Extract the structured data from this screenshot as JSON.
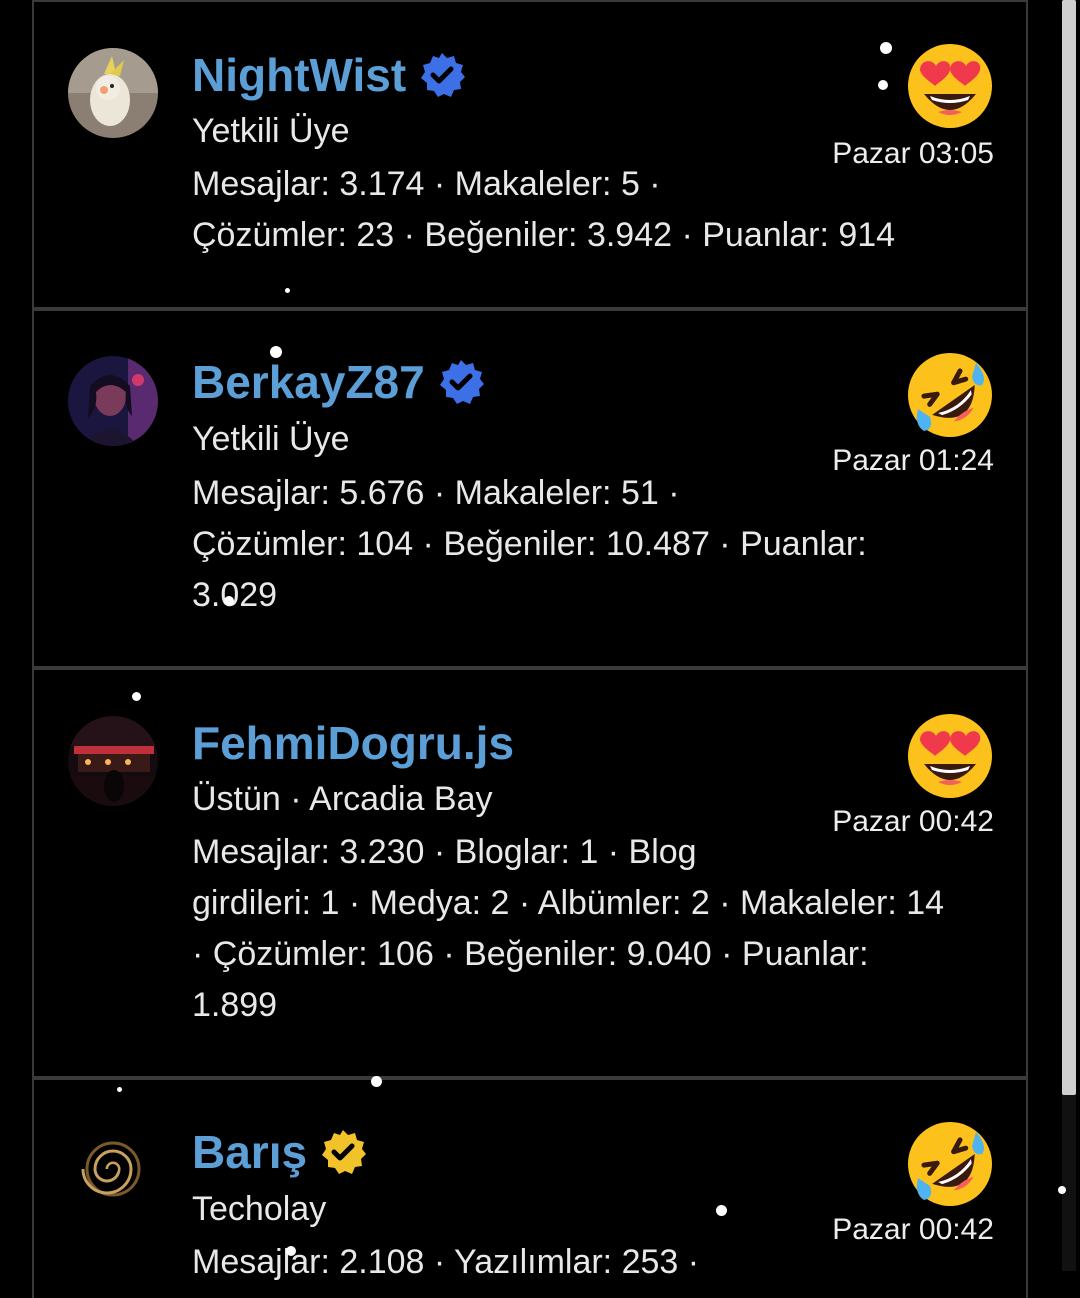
{
  "posts": [
    {
      "username": "NightWist",
      "verified_color": "#3d6fe6",
      "role": "Yetkili Üye",
      "stats_line1": "Mesajlar: 3.174 · Makaleler: 5 ·",
      "stats_line2": "Çözümler: 23 · Beğeniler: 3.942 · Puanlar: 914",
      "stats_line3": "",
      "stats_line4": "",
      "reaction": "heart-eyes-emoji",
      "time": "Pazar 03:05"
    },
    {
      "username": "BerkayZ87",
      "verified_color": "#3d6fe6",
      "role": "Yetkili Üye",
      "stats_line1": "Mesajlar: 5.676 · Makaleler: 51 ·",
      "stats_line2": "Çözümler: 104 · Beğeniler: 10.487 · Puanlar:",
      "stats_line3": "3.029",
      "stats_line4": "",
      "reaction": "rofl-emoji",
      "time": "Pazar 01:24"
    },
    {
      "username": "FehmiDogru.js",
      "verified_color": "",
      "role": "Üstün · Arcadia Bay",
      "stats_line1": "Mesajlar: 3.230 · Bloglar: 1 · Blog",
      "stats_line2": "girdileri: 1 · Medya: 2 · Albümler: 2 · Makaleler: 14",
      "stats_line3": "· Çözümler: 106 · Beğeniler: 9.040 · Puanlar:",
      "stats_line4": "1.899",
      "reaction": "heart-eyes-emoji",
      "time": "Pazar 00:42"
    },
    {
      "username": "Barış",
      "verified_color": "#f2c22b",
      "role": "Techolay",
      "stats_line1": "Mesajlar: 2.108 · Yazılımlar: 253 ·",
      "stats_line2": "",
      "stats_line3": "",
      "stats_line4": "",
      "reaction": "rofl-emoji",
      "time": "Pazar 00:42"
    }
  ]
}
